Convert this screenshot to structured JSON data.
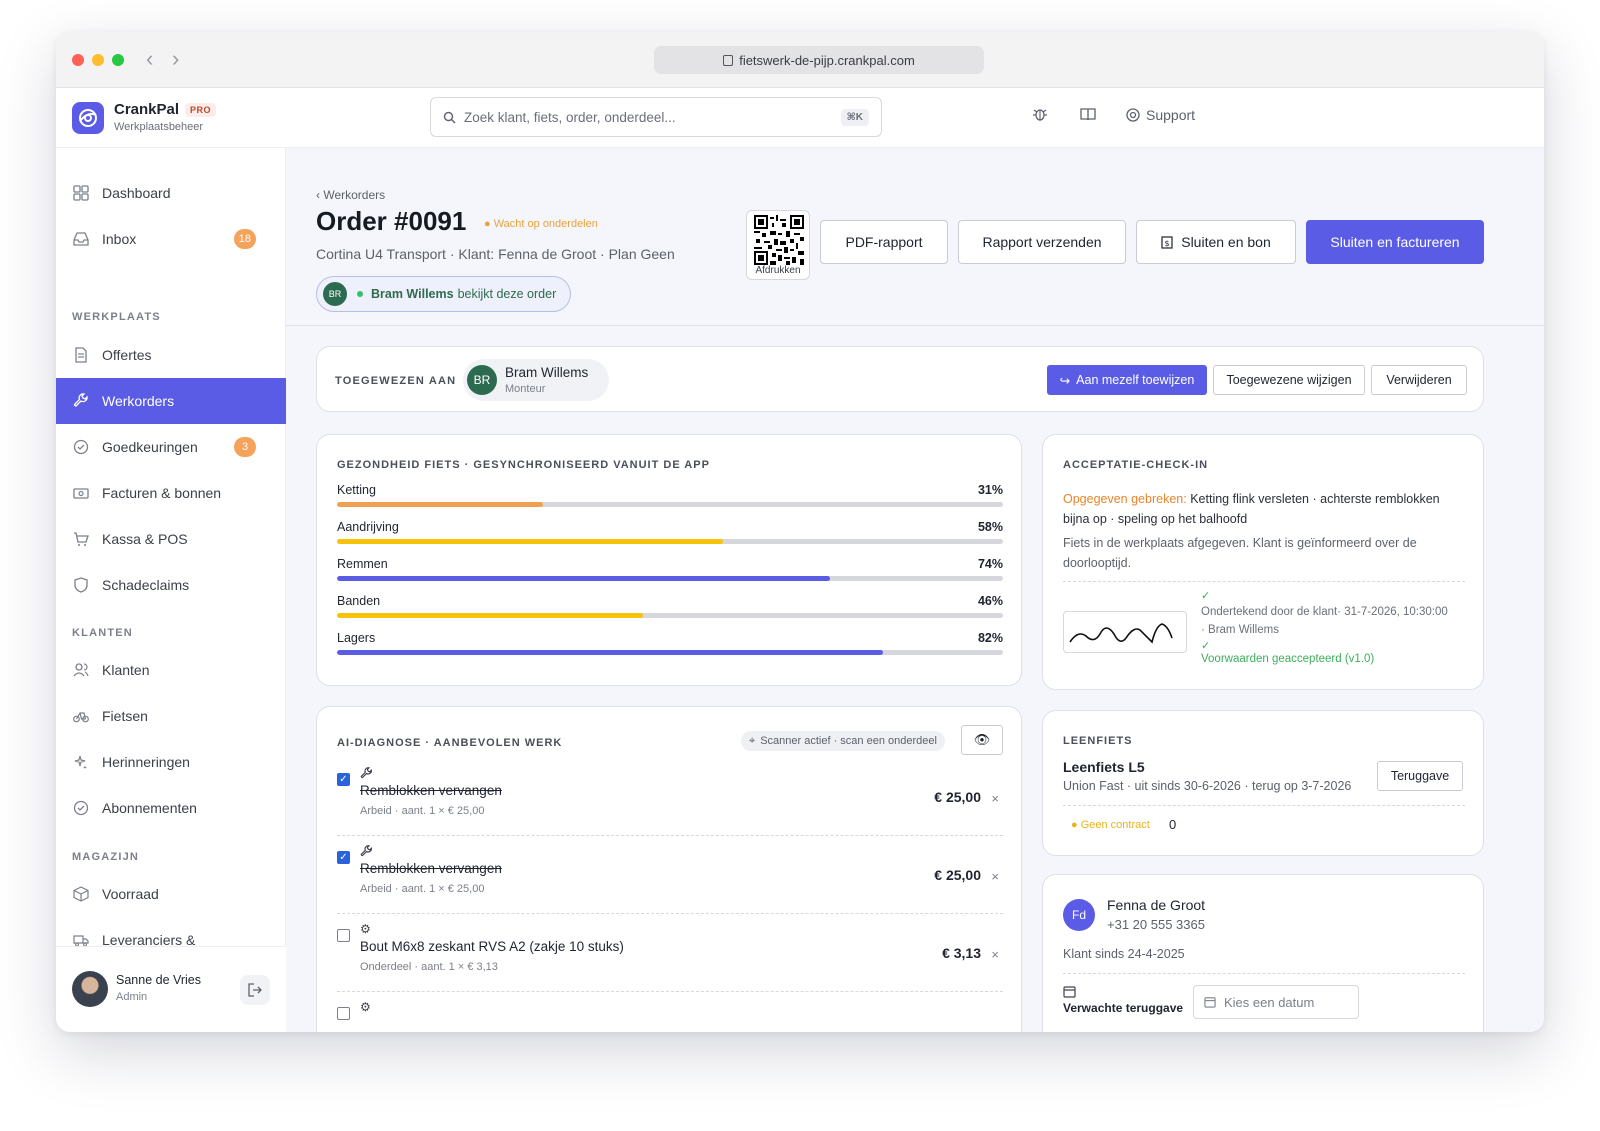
{
  "browser": {
    "url": "fietswerk-de-pijp.crankpal.com"
  },
  "header": {
    "brand": "CrankPal",
    "badge": "PRO",
    "subtitle": "Werkplaatsbeheer",
    "search_placeholder": "Zoek klant, fiets, order, onderdeel...",
    "search_shortcut": "⌘K",
    "support_label": "Support"
  },
  "sidebar": {
    "items": [
      {
        "label": "Dashboard",
        "icon": "grid-icon"
      },
      {
        "label": "Inbox",
        "icon": "inbox-icon",
        "badge": "18"
      },
      {
        "label": "Offertes",
        "icon": "document-icon"
      },
      {
        "label": "Werkorders",
        "icon": "wrench-icon",
        "active": true
      },
      {
        "label": "Goedkeuringen",
        "icon": "check-circle-icon",
        "badge": "3"
      },
      {
        "label": "Facturen & bonnen",
        "icon": "banknote-icon"
      },
      {
        "label": "Kassa & POS",
        "icon": "cart-icon"
      },
      {
        "label": "Schadeclaims",
        "icon": "shield-icon"
      },
      {
        "label": "Klanten",
        "icon": "users-icon"
      },
      {
        "label": "Fietsen",
        "icon": "bike-icon"
      },
      {
        "label": "Herinneringen",
        "icon": "sparkle-icon"
      },
      {
        "label": "Abonnementen",
        "icon": "check-circle-icon"
      },
      {
        "label": "Voorraad",
        "icon": "box-icon"
      },
      {
        "label": "Leveranciers &",
        "icon": "truck-icon"
      }
    ],
    "sections": [
      "WERKPLAATS",
      "KLANTEN",
      "MAGAZIJN"
    ],
    "user": {
      "name": "Sanne de Vries",
      "role": "Admin"
    }
  },
  "order": {
    "breadcrumb": "‹ Werkorders",
    "title": "Order #0091",
    "status": "Wacht op onderdelen",
    "subtitle": "Cortina U4 Transport · Klant: Fenna de Groot · Plan Geen",
    "viewer_initials": "BR",
    "viewer_name": "Bram Willems",
    "viewer_rest": "bekijkt deze order",
    "qr_label": "Afdrukken",
    "buttons": {
      "pdf": "PDF-rapport",
      "send": "Rapport verzenden",
      "close_receipt": "Sluiten en bon",
      "close_invoice": "Sluiten en factureren"
    }
  },
  "assigned": {
    "label": "TOEGEWEZEN AAN",
    "initials": "BR",
    "name": "Bram Willems",
    "role": "Monteur",
    "assign_self": "Aan mezelf toewijzen",
    "change": "Toegewezene wijzigen",
    "remove": "Verwijderen"
  },
  "health": {
    "title": "GEZONDHEID FIETS · GESYNCHRONISEERD VANUIT DE APP",
    "rows": [
      {
        "name": "Ketting",
        "percent_label": "31%",
        "value": 31,
        "color": "#f0a050"
      },
      {
        "name": "Aandrijving",
        "percent_label": "58%",
        "value": 58,
        "color": "#f7c20a"
      },
      {
        "name": "Remmen",
        "percent_label": "74%",
        "value": 74,
        "color": "#5a5ce6"
      },
      {
        "name": "Banden",
        "percent_label": "46%",
        "value": 46,
        "color": "#f7c20a"
      },
      {
        "name": "Lagers",
        "percent_label": "82%",
        "value": 82,
        "color": "#5a5ce6"
      }
    ]
  },
  "acceptance": {
    "title": "ACCEPTATIE-CHECK-IN",
    "defects_label": "Opgegeven gebreken:",
    "defects_text": "Ketting flink versleten · achterste remblokken bijna op · speling op het balhoofd",
    "note": "Fiets in de werkplaats afgegeven. Klant is geïnformeerd over de doorlooptijd.",
    "signed": "Ondertekend door de klant· 31-7-2026, 10:30:00",
    "signed_by": "· Bram Willems",
    "terms": "Voorwaarden geaccepteerd (v1.0)"
  },
  "ai": {
    "title": "AI-DIAGNOSE · AANBEVOLEN WERK",
    "scanner": "Scanner actief · scan een onderdeel",
    "items": [
      {
        "title": "Remblokken vervangen",
        "meta": "Arbeid · aant. 1 × € 25,00",
        "price": "€ 25,00",
        "checked": true,
        "icon": "wrench-icon"
      },
      {
        "title": "Remblokken vervangen",
        "meta": "Arbeid · aant. 1 × € 25,00",
        "price": "€ 25,00",
        "checked": true,
        "icon": "wrench-icon"
      },
      {
        "title": "Bout M6x8 zeskant RVS A2 (zakje 10 stuks)",
        "meta": "Onderdeel · aant. 1 × € 3,13",
        "price": "€ 3,13",
        "checked": false,
        "icon": "gear-icon"
      }
    ]
  },
  "loaner": {
    "title": "LEENFIETS",
    "name": "Leenfiets L5",
    "details": "Union Fast · uit sinds 30-6-2026 · terug op 3-7-2026",
    "return_button": "Teruggave",
    "contract": "Geen contract",
    "count": "0"
  },
  "customer": {
    "initials": "Fd",
    "name": "Fenna de Groot",
    "phone": "+31 20 555 3365",
    "since": "Klant sinds 24-4-2025",
    "expected_return_label": "Verwachte teruggave",
    "date_placeholder": "Kies een datum"
  }
}
